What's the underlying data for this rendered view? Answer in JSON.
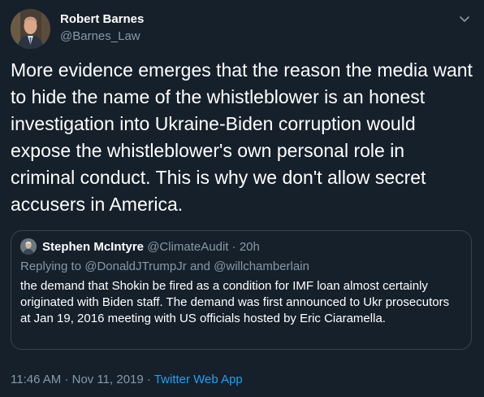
{
  "author": {
    "name": "Robert Barnes",
    "handle": "@Barnes_Law"
  },
  "tweet": {
    "text": "More evidence emerges that the reason the media want to hide the name of the whistleblower is an honest investigation into Ukraine-Biden corruption would expose the whistleblower's own personal role in criminal conduct. This is why we don't allow secret accusers in America."
  },
  "quoted": {
    "name": "Stephen McIntyre",
    "handle": "@ClimateAudit",
    "separator": "·",
    "time": "20h",
    "replying_prefix": "Replying to",
    "replying_to_1": "@DonaldJTrumpJr",
    "replying_and": "and",
    "replying_to_2": "@willchamberlain",
    "text": "the demand that Shokin be fired as a condition for IMF loan almost certainly originated with Biden staff. The demand was first announced to Ukr prosecutors at Jan 19, 2016 meeting with US officials hosted by Eric Ciaramella."
  },
  "footer": {
    "time": "11:46 AM",
    "separator": "·",
    "date": "Nov 11, 2019",
    "separator2": "·",
    "app": "Twitter Web App"
  },
  "icons": {
    "menu": "chevron-down-icon"
  },
  "colors": {
    "background": "#15202b",
    "text": "#ffffff",
    "secondary": "#8899a6",
    "accent": "#1da1f2",
    "border": "#38444d"
  }
}
